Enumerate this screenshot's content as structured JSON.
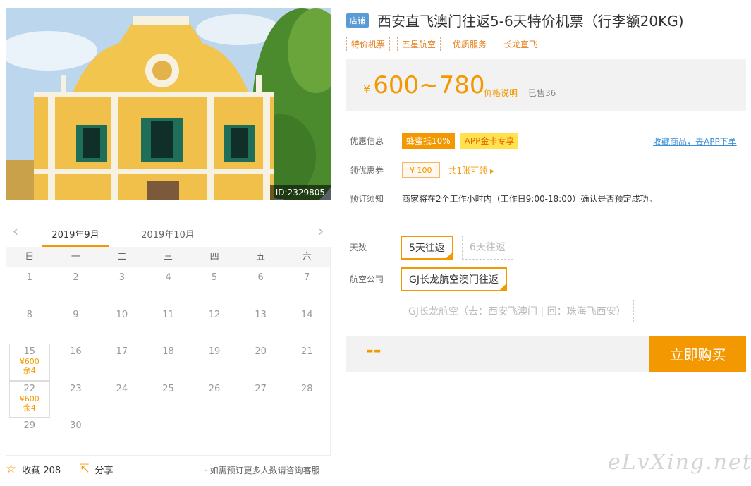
{
  "photo": {
    "id_label": "ID:2329805"
  },
  "calendar": {
    "prev_arrow": "‹",
    "next_arrow": "›",
    "months": [
      "2019年9月",
      "2019年10月"
    ],
    "weekdays": [
      "日",
      "一",
      "二",
      "三",
      "四",
      "五",
      "六"
    ],
    "start_offset": 0,
    "days": [
      {
        "d": "1"
      },
      {
        "d": "2"
      },
      {
        "d": "3"
      },
      {
        "d": "4"
      },
      {
        "d": "5"
      },
      {
        "d": "6"
      },
      {
        "d": "7"
      },
      {
        "d": "8"
      },
      {
        "d": "9"
      },
      {
        "d": "10"
      },
      {
        "d": "11"
      },
      {
        "d": "12"
      },
      {
        "d": "13"
      },
      {
        "d": "14"
      },
      {
        "d": "15",
        "price": "¥600",
        "stock": "余4"
      },
      {
        "d": "16"
      },
      {
        "d": "17"
      },
      {
        "d": "18"
      },
      {
        "d": "19"
      },
      {
        "d": "20"
      },
      {
        "d": "21"
      },
      {
        "d": "22",
        "price": "¥600",
        "stock": "余4"
      },
      {
        "d": "23"
      },
      {
        "d": "24"
      },
      {
        "d": "25"
      },
      {
        "d": "26"
      },
      {
        "d": "27"
      },
      {
        "d": "28"
      },
      {
        "d": "29"
      },
      {
        "d": "30"
      }
    ]
  },
  "footer": {
    "favorite_icon": "star-icon",
    "favorite_label": "收藏 208",
    "share_icon": "share-icon",
    "share_label": "分享",
    "note": "· 如需预订更多人数请咨询客服"
  },
  "product": {
    "shop_tag": "店铺",
    "title": "西安直飞澳门往返5-6天特价机票（行李额20KG)",
    "tags": [
      "特价机票",
      "五星航空",
      "优质服务",
      "长龙直飞"
    ],
    "price_currency": "¥",
    "price_range": "600~780",
    "price_note": "价格说明",
    "sold": "已售36"
  },
  "promo": {
    "label": "优惠信息",
    "badge1": "蜂蜜抵10%",
    "badge2": "APP金卡专享",
    "fav_link": "收藏商品，去APP下单"
  },
  "coupon": {
    "label": "领优惠券",
    "value": "¥ 100",
    "note": "共1张可领 ▸"
  },
  "booking": {
    "label": "预订须知",
    "text": "商家将在2个工作小时内（工作日9:00-18:00）确认是否预定成功。"
  },
  "days_option": {
    "label": "天数",
    "options": [
      "5天往返",
      "6天往返"
    ],
    "selected": 0
  },
  "airline_option": {
    "label": "航空公司",
    "options": [
      "GJ长龙航空澳门往返",
      "GJ长龙航空（去：西安飞澳门 | 回：珠海飞西安）"
    ],
    "selected": 0
  },
  "buy": {
    "total": "--",
    "button": "立即购买"
  },
  "watermark": "eLvXing.net",
  "colors": {
    "accent": "#f39800",
    "link": "#3d8fd4",
    "shop_tag": "#5b9bd5"
  }
}
